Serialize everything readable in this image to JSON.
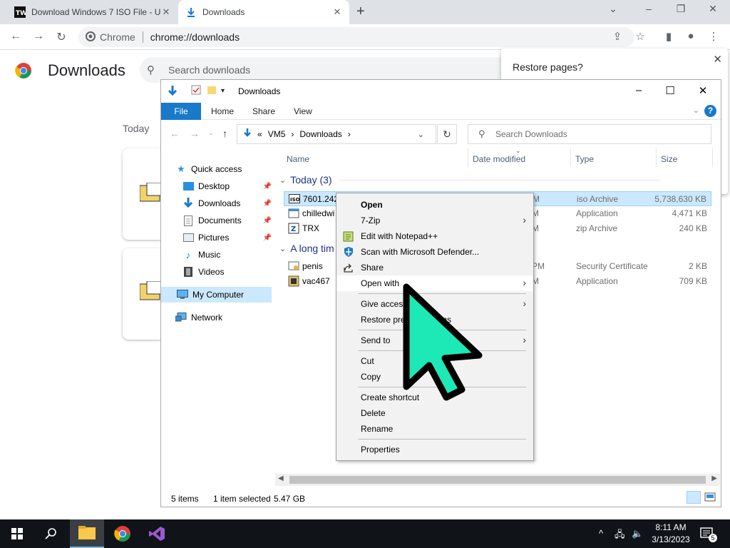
{
  "chrome": {
    "tabs": [
      {
        "title": "Download Windows 7 ISO File - U",
        "favicon": "tw-logo-icon"
      },
      {
        "title": "Downloads",
        "favicon": "download-icon"
      }
    ],
    "address": {
      "origin_label": "Chrome",
      "url": "chrome://downloads"
    },
    "page_title": "Downloads",
    "search_placeholder": "Search downloads",
    "today_label": "Today",
    "restore_popup": {
      "text": "Restore pages?"
    }
  },
  "explorer": {
    "title": "Downloads",
    "ribbon": {
      "file": "File",
      "tabs": [
        "Home",
        "Share",
        "View"
      ],
      "help": "?"
    },
    "path": {
      "prefix": "«",
      "segments": [
        "VM5",
        "Downloads"
      ],
      "separator": "›"
    },
    "search_placeholder": "Search Downloads",
    "nav": [
      {
        "label": "Quick access",
        "icon": "star-icon",
        "pinned": false
      },
      {
        "label": "Desktop",
        "icon": "desktop-icon",
        "pinned": true
      },
      {
        "label": "Downloads",
        "icon": "download-arrow-icon",
        "pinned": true
      },
      {
        "label": "Documents",
        "icon": "document-icon",
        "pinned": true
      },
      {
        "label": "Pictures",
        "icon": "picture-icon",
        "pinned": true
      },
      {
        "label": "Music",
        "icon": "music-note-icon",
        "pinned": false
      },
      {
        "label": "Videos",
        "icon": "film-icon",
        "pinned": false
      },
      {
        "label": "My Computer",
        "icon": "computer-icon",
        "pinned": false,
        "selected": true
      },
      {
        "label": "Network",
        "icon": "network-icon",
        "pinned": false
      }
    ],
    "columns": [
      "Name",
      "Date modified",
      "Type",
      "Size"
    ],
    "groups": [
      {
        "label": "Today (3)",
        "rows": [
          {
            "name": "7601.2421",
            "date": "M",
            "type": "iso Archive",
            "size": "5,738,630 KB",
            "selected": true
          },
          {
            "name": "chilledwi",
            "date": "M",
            "type": "Application",
            "size": "4,471 KB"
          },
          {
            "name": "TRX",
            "date": "M",
            "type": "zip Archive",
            "size": "240 KB"
          }
        ]
      },
      {
        "label": "A long tim",
        "rows": [
          {
            "name": "penis",
            "date": "PM",
            "type": "Security Certificate",
            "size": "2 KB"
          },
          {
            "name": "vac467",
            "date": "M",
            "type": "Application",
            "size": "709 KB"
          }
        ]
      }
    ],
    "status": {
      "items": "5 items",
      "selected": "1 item selected",
      "size": "5.47 GB"
    }
  },
  "context_menu": {
    "items": [
      {
        "label": "Open",
        "bold": true
      },
      {
        "label": "7-Zip",
        "submenu": true
      },
      {
        "label": "Edit with Notepad++",
        "icon": "notepad-plus-icon"
      },
      {
        "label": "Scan with Microsoft Defender...",
        "icon": "defender-shield-icon"
      },
      {
        "label": "Share",
        "icon": "share-icon"
      },
      {
        "label": "Open with",
        "submenu": true,
        "highlighted": true
      },
      {
        "label": "Give access t",
        "submenu": true
      },
      {
        "label": "Restore prev",
        "suffix": "ions"
      },
      {
        "label": "Send to",
        "submenu": true
      },
      {
        "label": "Cut"
      },
      {
        "label": "Copy"
      },
      {
        "label": "Create shortcut"
      },
      {
        "label": "Delete"
      },
      {
        "label": "Rename"
      },
      {
        "label": "Properties"
      }
    ]
  },
  "taskbar": {
    "clock_time": "8:11 AM",
    "clock_date": "3/13/2023",
    "notification_count": "5"
  },
  "colors": {
    "accent_blue": "#1979ca",
    "selection": "#cce8ff",
    "cursor_fill": "#1de9b6",
    "taskbar": "#101418"
  }
}
